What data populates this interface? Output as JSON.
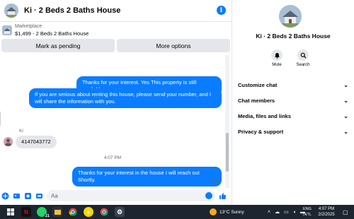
{
  "chat": {
    "title": "Ki · 2 Beds 2 Baths House",
    "listing": {
      "source": "Marketplace",
      "price_title": "$1,499 - 2 Beds 2 Baths House"
    },
    "actions": {
      "mark_pending": "Mark as pending",
      "more_options": "More options"
    },
    "messages": [
      {
        "direction": "outgoing",
        "text": "Thanks for your interest. Yes This property is still available."
      },
      {
        "direction": "outgoing",
        "text": "If you are serious about renting this house, please send your number, and I will share the information with you."
      },
      {
        "direction": "incoming",
        "sender": "Ki",
        "text": "4147043772"
      },
      {
        "direction": "outgoing",
        "text": "Thanks for your interest in the house I will reach out Shortly."
      }
    ],
    "timestamp": "4:07 PM",
    "sent_status": "Sent",
    "composer": {
      "placeholder": "Aa"
    }
  },
  "details": {
    "title": "Ki · 2 Beds 2 Baths House",
    "quick_actions": {
      "mute": "Mute",
      "search": "Search"
    },
    "menu": [
      "Customize chat",
      "Chat members",
      "Media, files and links",
      "Privacy & support"
    ]
  },
  "taskbar": {
    "weather": "13°C  Sunny",
    "lang": {
      "line1": "ENG",
      "line2": "INTL"
    },
    "clock": {
      "time": "4:07 PM",
      "date": "2/2/2025"
    },
    "notification_count": "21"
  },
  "colors": {
    "accent": "#0a7cff",
    "bubble_in": "#e4e6eb",
    "taskbar": "#1c2530"
  }
}
